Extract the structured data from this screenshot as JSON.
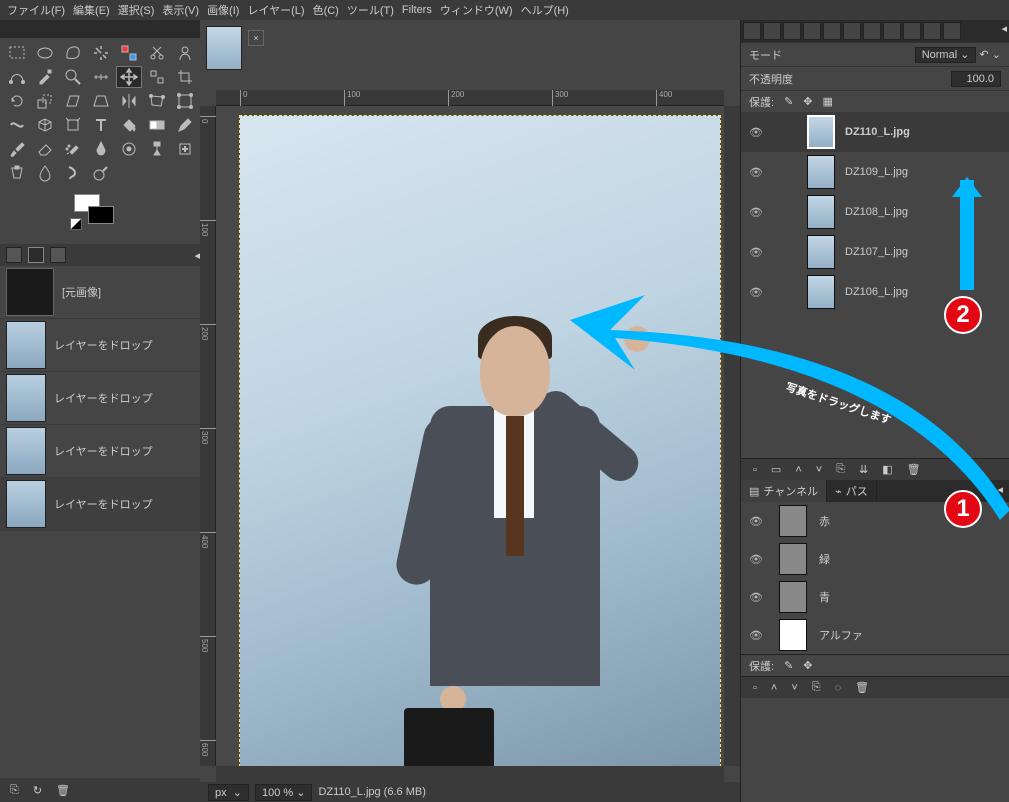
{
  "menu": {
    "file": "ファイル(F)",
    "edit": "編集(E)",
    "select": "選択(S)",
    "view": "表示(V)",
    "image": "画像(I)",
    "layer": "レイヤー(L)",
    "colors": "色(C)",
    "tools": "ツール(T)",
    "filters": "Filters",
    "windows": "ウィンドウ(W)",
    "help": "ヘルプ(H)"
  },
  "undo": {
    "original": "[元画像]",
    "drop": "レイヤーをドロップ"
  },
  "status": {
    "unit": "px",
    "zoom": "100 %",
    "file": "DZ110_L.jpg (6.6 MB)"
  },
  "ruler_h": [
    "0",
    "100",
    "200",
    "300",
    "400"
  ],
  "ruler_v": [
    "0",
    "100",
    "200",
    "300",
    "400",
    "500",
    "600"
  ],
  "layer_panel": {
    "mode_label": "モード",
    "mode_value": "Normal",
    "opacity_label": "不透明度",
    "opacity_value": "100.0",
    "lock_label": "保護:"
  },
  "layers": [
    {
      "name": "DZ110_L.jpg"
    },
    {
      "name": "DZ109_L.jpg"
    },
    {
      "name": "DZ108_L.jpg"
    },
    {
      "name": "DZ107_L.jpg"
    },
    {
      "name": "DZ106_L.jpg"
    }
  ],
  "ch_tabs": {
    "channels": "チャンネル",
    "paths": "パス"
  },
  "channels": {
    "r": "赤",
    "g": "緑",
    "b": "青",
    "a": "アルファ",
    "lock": "保護:"
  },
  "annot": {
    "drag": "写真をドラッグします",
    "b1": "1",
    "b2": "2"
  }
}
